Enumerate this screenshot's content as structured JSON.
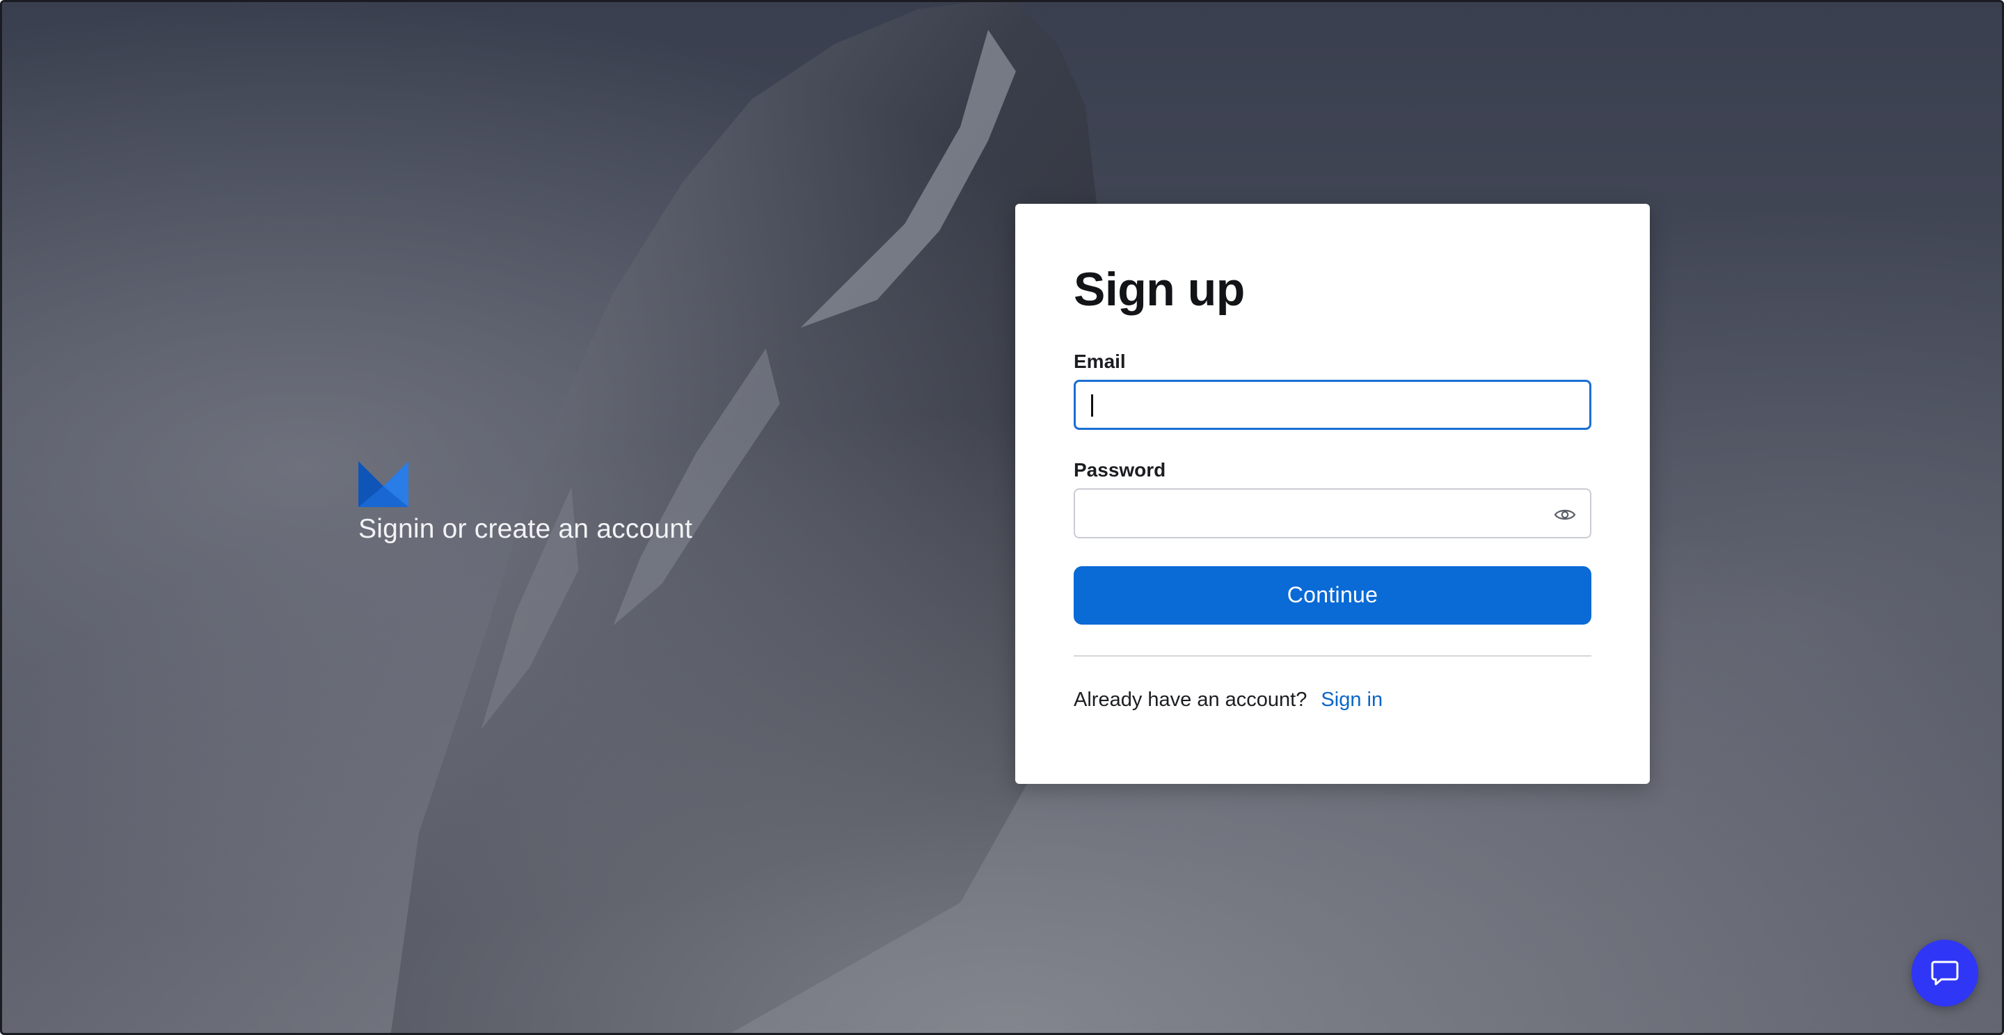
{
  "brand": {
    "tagline": "Signin or create an account",
    "logo_icon": "m-logo-icon",
    "logo_color": "#1967d2"
  },
  "signup": {
    "title": "Sign up",
    "email": {
      "label": "Email",
      "value": "",
      "placeholder": ""
    },
    "password": {
      "label": "Password",
      "value": "",
      "placeholder": "",
      "toggle_icon": "eye-icon"
    },
    "continue_label": "Continue",
    "footer_text": "Already have an account?",
    "sign_in_link": "Sign in"
  },
  "chat": {
    "icon": "chat-bubble-icon",
    "color": "#2f36f5"
  },
  "colors": {
    "accent": "#0a6ad6",
    "focus_border": "#1b6ed3",
    "link": "#0a66c8"
  }
}
